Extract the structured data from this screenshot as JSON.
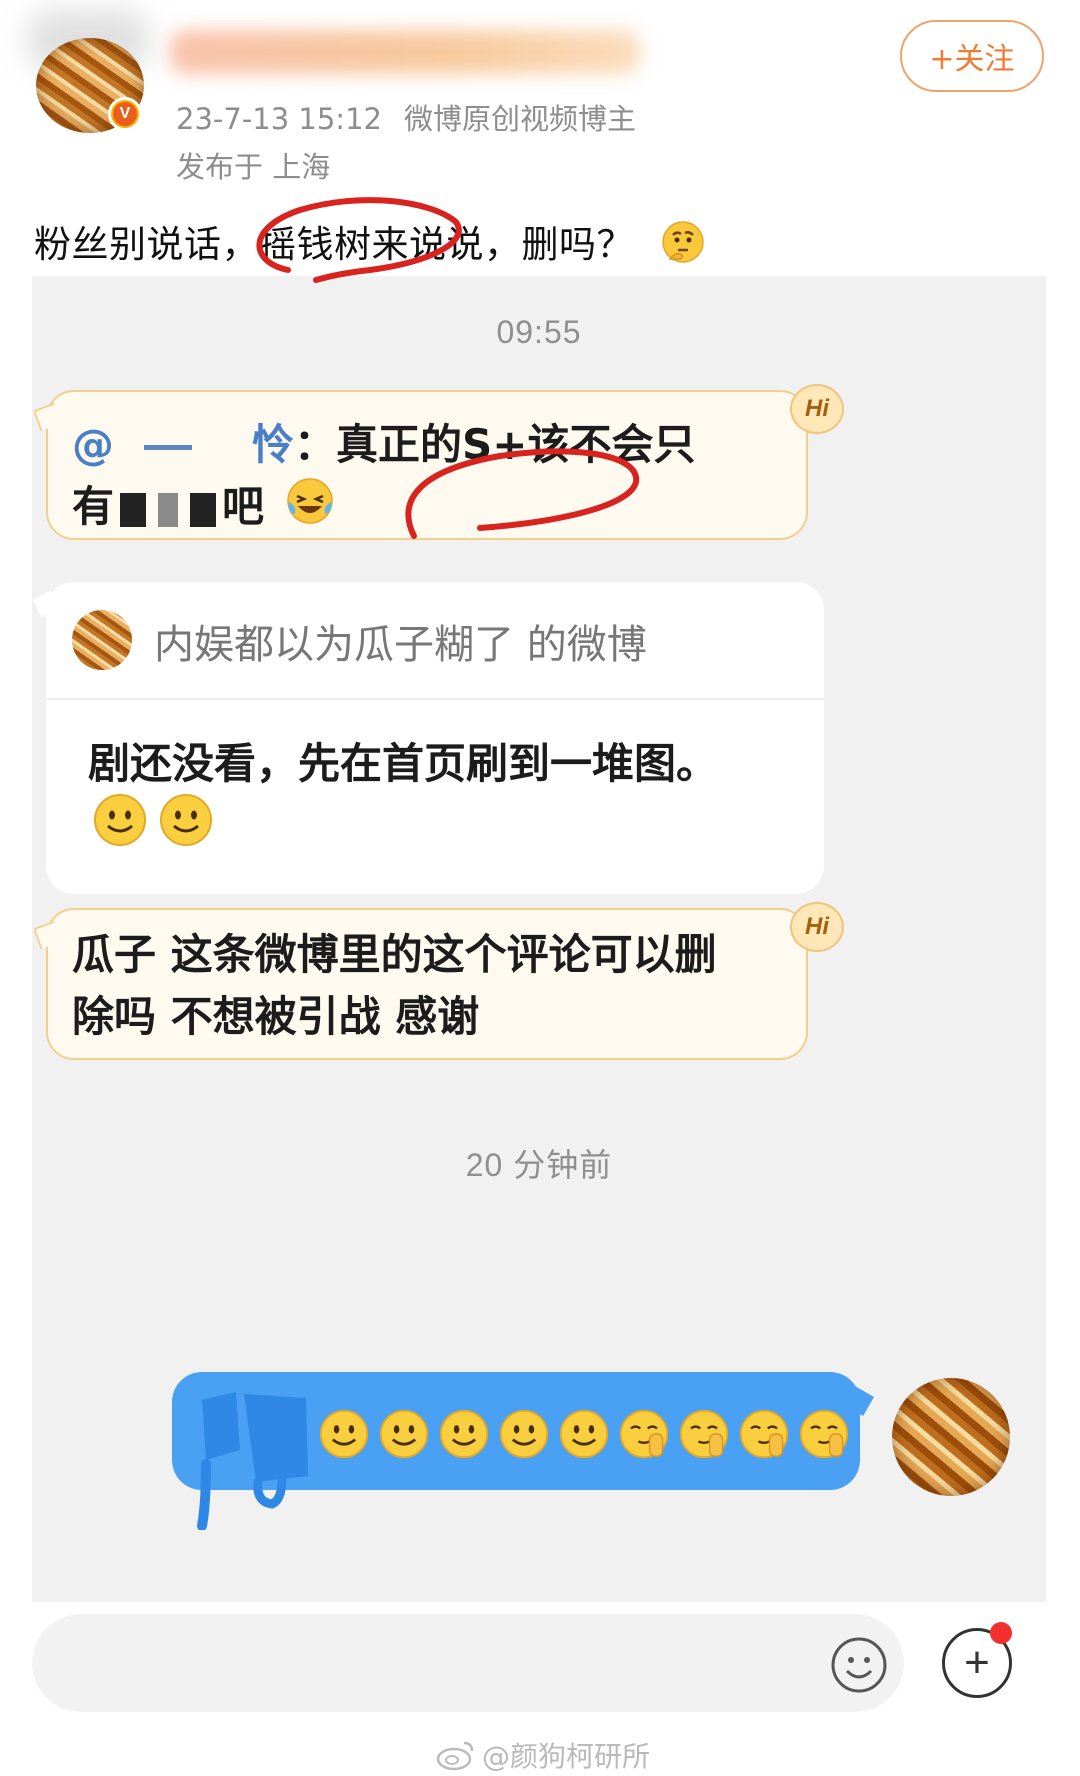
{
  "post": {
    "timestamp": "23-7-13 15:12",
    "author_title": "微博原创视频博主",
    "location": "发布于 上海",
    "follow_label": "+关注",
    "text": "粉丝别说话，摇钱树来说说，删吗？",
    "emoji_icon": "thinking-face-icon"
  },
  "chat": {
    "time_top": "09:55",
    "message1": {
      "mention": "@",
      "name_tail": "怜",
      "text_line1": "：真正的S+该不会只",
      "text_line2_start": "有",
      "text_line2_end": "吧",
      "badge": "Hi",
      "emoji_icon": "laughing-tears-icon"
    },
    "shared_card": {
      "title": "内娱都以为瓜子糊了 的微博",
      "body": "剧还没看，先在首页刷到一堆图。",
      "emoji_icons": [
        "smile-icon",
        "smile-icon"
      ]
    },
    "message2": {
      "line1": "瓜子 这条微博里的这个评论可以删",
      "line2": "除吗 不想被引战 感谢",
      "badge": "Hi"
    },
    "time_bottom": "20 分钟前",
    "my_reply": {
      "emoji_icons": [
        "smile-icon",
        "smile-icon",
        "smile-icon",
        "smile-icon",
        "smile-icon",
        "shy-face-icon",
        "shy-face-icon",
        "shy-face-icon",
        "shy-face-icon"
      ]
    }
  },
  "input_bar": {
    "emoji_button": "emoji-face-icon",
    "plus_button": "+"
  },
  "watermark": "@颜狗柯研所",
  "colors": {
    "accent_orange": "#ef7c32",
    "bubble_border": "#f3cf8e",
    "my_bubble": "#4aa1f3",
    "annotation_red": "#d8231f"
  }
}
